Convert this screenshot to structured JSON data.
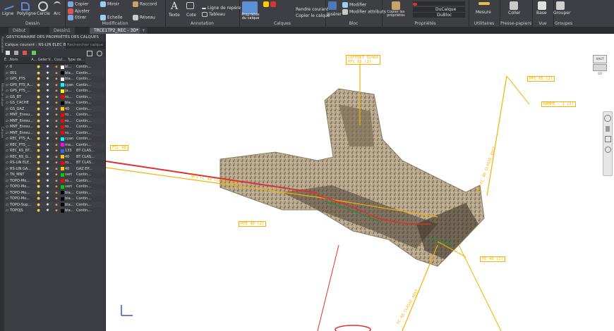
{
  "ribbon": {
    "draw_group": "Dessin",
    "draw_items": [
      "Ligne",
      "Polyligne",
      "Cercle",
      "Arc"
    ],
    "modify_group": "Modification",
    "modify_items": [
      "Copier",
      "Miroir",
      "Raccord",
      "Ajuster",
      "Etirer",
      "Echelle",
      "Réseau"
    ],
    "annotation_group": "Annotation",
    "annotation_items": [
      "Texte",
      "Cote",
      "Ligne de repère",
      "Tableau"
    ],
    "layers_group": "Calques",
    "layer_props_label": "Propriétés du calque",
    "layers_items": [
      "Rendre courant",
      "Copier le calque"
    ],
    "block_group": "Bloc",
    "block_items": [
      "Insérer",
      "Modifier",
      "Modifier attributs"
    ],
    "properties_group": "Propriétés",
    "properties_items": [
      "Copier les propriétés",
      "DuCalque",
      "DuBloc"
    ],
    "utilities_group": "Utilitaires",
    "utilities_item": "Mesure",
    "clipboard_group": "Presse-papiers",
    "clipboard_item": "Coller",
    "view_group": "Vue",
    "view_item": "Base",
    "groups_group": "Groupes",
    "groups_item": "Grouper"
  },
  "tabs": [
    "Début",
    "Dessin1",
    "TRCE1TP2_REC - 3D*"
  ],
  "panel": {
    "title": "GESTIONNAIRE DES PROPRIÉTÉS DES CALQUES",
    "current_layer": "Calque courant : RS-LIN ELEC BT &...",
    "search_placeholder": "Rechercher calque",
    "side_tabs": [
      "Paramètres",
      "Filtres de calque",
      "Calques"
    ],
    "columns": [
      "É...",
      "Nom",
      "A...",
      "Geler",
      "V...",
      "Coul...",
      "Type de..."
    ],
    "rows": [
      {
        "name": "0",
        "color": "#ffffff",
        "color_label": "bl...",
        "linetype": "Contin..."
      },
      {
        "name": "001",
        "color": "#000000",
        "color_label": "bla...",
        "linetype": "Contin..."
      },
      {
        "name": "GPS_PTS",
        "color": "#ffffff",
        "color_label": "bla...",
        "linetype": "Contin..."
      },
      {
        "name": "GPS_PTS_A...",
        "color": "#00ffff",
        "color_label": "cyan",
        "linetype": "Contin..."
      },
      {
        "name": "GPS_PTS_...",
        "color": "#ffff00",
        "color_label": "ja...",
        "linetype": "Contin..."
      },
      {
        "name": "GS_BT",
        "color": "#ff0000",
        "color_label": "ro...",
        "linetype": "Contin..."
      },
      {
        "name": "GS_CACHE",
        "color": "#000000",
        "color_label": "bla...",
        "linetype": "Contin..."
      },
      {
        "name": "GS_GAZ",
        "color": "#ffcc00",
        "color_label": "40",
        "linetype": "Contin..."
      },
      {
        "name": "MNT_Enreu...",
        "color": "#ff0000",
        "color_label": "ro...",
        "linetype": "Contin..."
      },
      {
        "name": "MNT_Enreu...",
        "color": "#ff0000",
        "color_label": "ro...",
        "linetype": "Contin..."
      },
      {
        "name": "MNT_Enreu...",
        "color": "#ff0000",
        "color_label": "ro...",
        "linetype": "Contin..."
      },
      {
        "name": "MNT_Enreu...",
        "color": "#ff0000",
        "color_label": "ro...",
        "linetype": "Contin..."
      },
      {
        "name": "REC_PTS_A...",
        "color": "#00ffff",
        "color_label": "cyan",
        "linetype": "Contin..."
      },
      {
        "name": "REC_PTS_...",
        "color": "#ff00ff",
        "color_label": "ma...",
        "linetype": "Contin..."
      },
      {
        "name": "REC_RS_BT...",
        "color": "#3366ff",
        "color_label": "133",
        "linetype": "BT CLAS..."
      },
      {
        "name": "REC_RS_G...",
        "color": "#ffcc00",
        "color_label": "40",
        "linetype": "BT CLAS..."
      },
      {
        "name": "RS-LIN ELE...",
        "color": "#ff0000",
        "color_label": "ro...",
        "linetype": "BT CLAS..."
      },
      {
        "name": "RS-LIN GA...",
        "color": "#ffcc00",
        "color_label": "40",
        "linetype": "GAZ EP..."
      },
      {
        "name": "TN_MNT",
        "color": "#00cc00",
        "color_label": "vert",
        "linetype": "Contin..."
      },
      {
        "name": "TOPO-Mo...",
        "color": "#ff0000",
        "color_label": "ro...",
        "linetype": "Contin..."
      },
      {
        "name": "TOPO-Mo...",
        "color": "#00cc00",
        "color_label": "vert",
        "linetype": "Contin..."
      },
      {
        "name": "TOPO-Mo...",
        "color": "#000000",
        "color_label": "bla...",
        "linetype": "Contin..."
      },
      {
        "name": "TOPO-Mo...",
        "color": "#000000",
        "color_label": "bla...",
        "linetype": "Contin..."
      },
      {
        "name": "TOPO-Sup...",
        "color": "#000000",
        "color_label": "bla...",
        "linetype": "Contin..."
      },
      {
        "name": "TOPOJS",
        "color": "#000000",
        "color_label": "bla...",
        "linetype": "Contin..."
      }
    ]
  },
  "viewport": {
    "navcube_label": "HAUT",
    "navcube_compass": "SO",
    "labels": [
      "COFFRET S2400",
      "PFC 65 (2)",
      "PFC 65 (2)",
      "RAMPE - 1 (2)",
      "FIL 40",
      "PFE 40 (2)"
    ],
    "pipe_text_1": "NFS FC 40 CLASSE A0ST",
    "pipe_text_2": "NFS FC 40 CLASSE A0ST",
    "pipe_text_3": "FC 40 CLASSE A0ST"
  },
  "colors": {
    "ribbon_bg": "#3d3f44",
    "panel_bg": "#3b3d42",
    "viewport_bg": "#ffffff",
    "annotation": "#f5b000",
    "bt_cable": "#e03030"
  }
}
